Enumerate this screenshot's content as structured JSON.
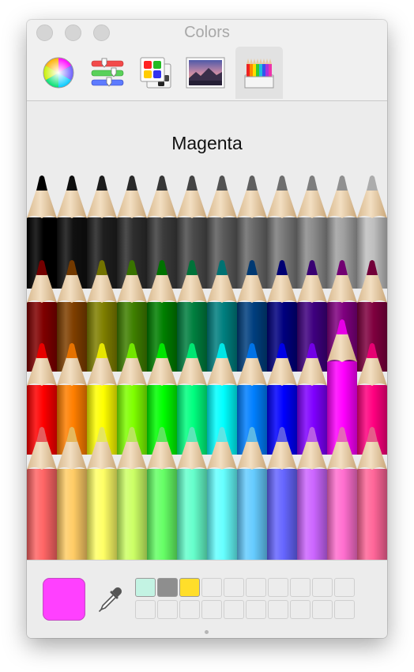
{
  "window": {
    "title": "Colors"
  },
  "toolbar": {
    "tabs": [
      {
        "id": "color-wheel",
        "icon": "color-wheel-icon"
      },
      {
        "id": "color-sliders",
        "icon": "color-sliders-icon"
      },
      {
        "id": "color-palettes",
        "icon": "color-palettes-icon"
      },
      {
        "id": "image-palettes",
        "icon": "image-palettes-icon"
      },
      {
        "id": "pencils",
        "icon": "pencils-icon",
        "selected": true
      }
    ]
  },
  "main": {
    "selected_color_name": "Magenta",
    "pencil_rows": [
      [
        "#000000",
        "#101010",
        "#1f1f1f",
        "#2e2e2e",
        "#3c3c3c",
        "#4b4b4b",
        "#5b5b5b",
        "#6a6a6a",
        "#7a7a7a",
        "#8b8b8b",
        "#a0a0a0",
        "#bfbfbf"
      ],
      [
        "#800000",
        "#7f3f00",
        "#7f7f00",
        "#3f7f00",
        "#007f00",
        "#007f3f",
        "#007f7f",
        "#003f7f",
        "#00007f",
        "#3f007f",
        "#7f007f",
        "#7f003f"
      ],
      [
        "#ff0000",
        "#ff7f00",
        "#ffff00",
        "#7fff00",
        "#00ff00",
        "#00ff7f",
        "#00ffff",
        "#007fff",
        "#0000ff",
        "#7f00ff",
        "#ff00ff",
        "#ff007f"
      ],
      [
        "#ff6666",
        "#ffcc66",
        "#ffff66",
        "#ccff66",
        "#66ff66",
        "#66ffcc",
        "#66ffff",
        "#66ccff",
        "#6666ff",
        "#cc66ff",
        "#ff6fcf",
        "#ff6699"
      ]
    ],
    "selected_pencil": {
      "row": 2,
      "col": 10
    }
  },
  "bottom": {
    "current_color": "#ff40ff",
    "favorites": [
      "#c3f3e3",
      "#8e8e8e",
      "#ffde2a",
      "",
      "",
      "",
      "",
      "",
      "",
      "",
      "",
      "",
      "",
      "",
      "",
      "",
      "",
      "",
      "",
      ""
    ]
  }
}
